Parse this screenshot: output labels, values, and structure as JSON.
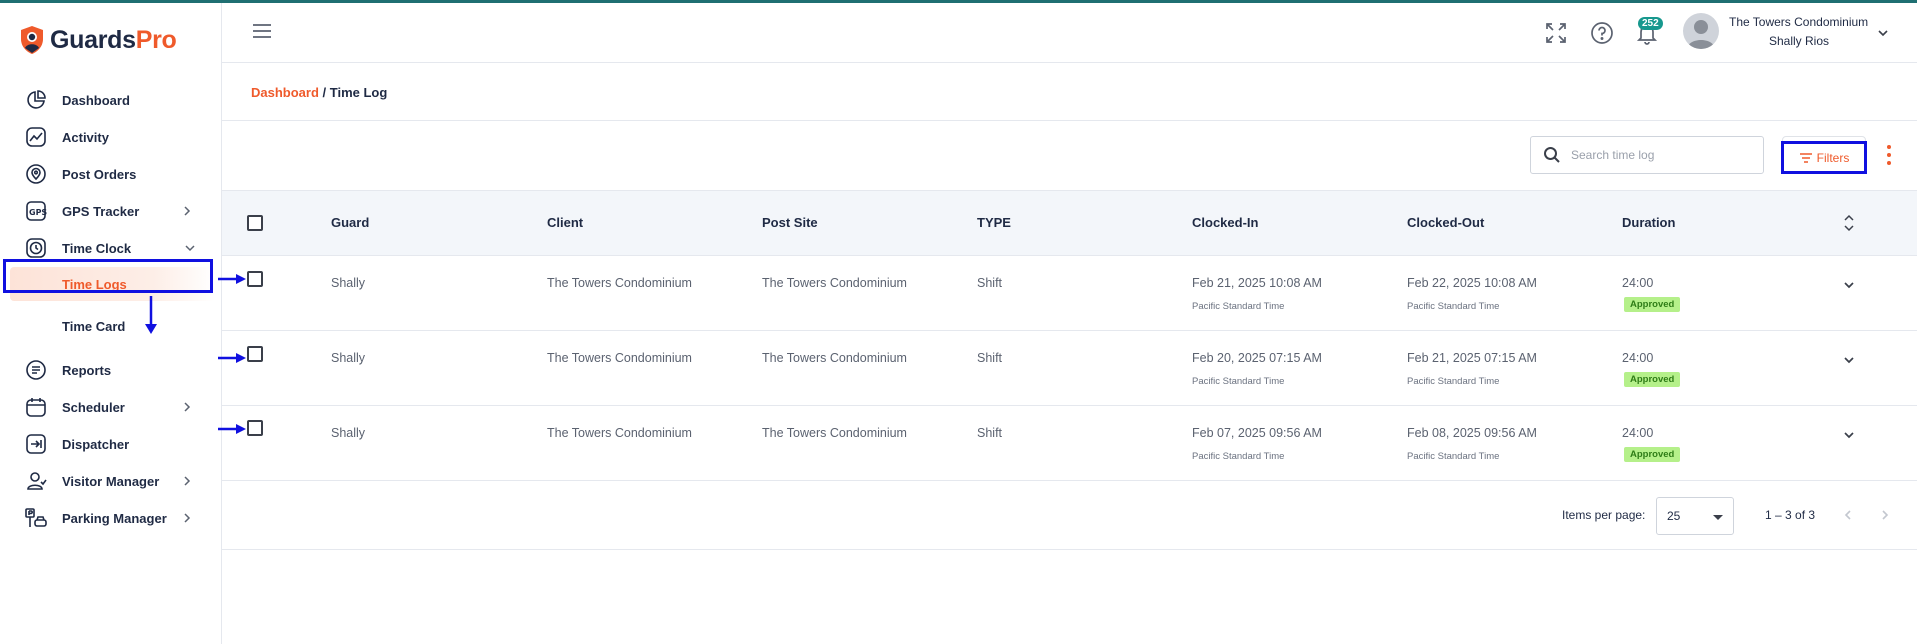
{
  "brand": {
    "part1": "Guards",
    "part2": "Pro"
  },
  "sidebar": {
    "items": [
      {
        "label": "Dashboard"
      },
      {
        "label": "Activity"
      },
      {
        "label": "Post Orders"
      },
      {
        "label": "GPS Tracker"
      },
      {
        "label": "Time Clock"
      },
      {
        "label": "Time Logs"
      },
      {
        "label": "Time Card"
      },
      {
        "label": "Reports"
      },
      {
        "label": "Scheduler"
      },
      {
        "label": "Dispatcher"
      },
      {
        "label": "Visitor Manager"
      },
      {
        "label": "Parking Manager"
      }
    ]
  },
  "header": {
    "notification_count": "252",
    "organization": "The Towers Condominium",
    "user_name": "Shally Rios"
  },
  "breadcrumb": {
    "root": "Dashboard",
    "separator": " / ",
    "current": "Time Log"
  },
  "toolbar": {
    "search_placeholder": "Search time log",
    "filters_label": "Filters"
  },
  "table": {
    "columns": [
      "Guard",
      "Client",
      "Post Site",
      "TYPE",
      "Clocked-In",
      "Clocked-Out",
      "Duration"
    ],
    "rows": [
      {
        "guard": "Shally",
        "client": "The Towers Condominium",
        "post_site": "The Towers Condominium",
        "type": "Shift",
        "clocked_in": "Feb 21, 2025 10:08 AM",
        "clocked_in_tz": "Pacific Standard Time",
        "clocked_out": "Feb 22, 2025 10:08 AM",
        "clocked_out_tz": "Pacific Standard Time",
        "duration": "24:00",
        "status": "Approved"
      },
      {
        "guard": "Shally",
        "client": "The Towers Condominium",
        "post_site": "The Towers Condominium",
        "type": "Shift",
        "clocked_in": "Feb 20, 2025 07:15 AM",
        "clocked_in_tz": "Pacific Standard Time",
        "clocked_out": "Feb 21, 2025 07:15 AM",
        "clocked_out_tz": "Pacific Standard Time",
        "duration": "24:00",
        "status": "Approved"
      },
      {
        "guard": "Shally",
        "client": "The Towers Condominium",
        "post_site": "The Towers Condominium",
        "type": "Shift",
        "clocked_in": "Feb 07, 2025 09:56 AM",
        "clocked_in_tz": "Pacific Standard Time",
        "clocked_out": "Feb 08, 2025 09:56 AM",
        "clocked_out_tz": "Pacific Standard Time",
        "duration": "24:00",
        "status": "Approved"
      }
    ]
  },
  "pagination": {
    "items_per_page_label": "Items per page:",
    "items_per_page": "25",
    "range": "1 – 3 of 3"
  },
  "colors": {
    "accent": "#ef5a2b",
    "primary_text": "#1f2a44",
    "annotation": "#1010e0",
    "status_bg": "#b5f08a",
    "badge": "#17988e"
  }
}
